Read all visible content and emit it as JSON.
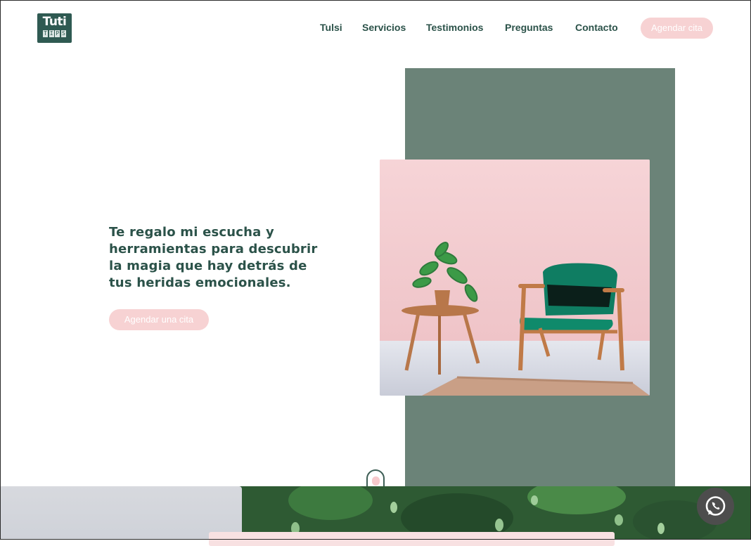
{
  "brand": {
    "logo_main": "Tuti",
    "logo_sub": [
      "T",
      "I",
      "P",
      "S"
    ]
  },
  "nav": {
    "items": [
      "Tulsi",
      "Servicios",
      "Testimonios",
      "Preguntas",
      "Contacto"
    ],
    "cta_label": "Agendar cita"
  },
  "hero": {
    "headline": "Te regalo mi escucha y herramientas para descubrir la magia que hay detrás de tus heridas emocionales.",
    "cta_label": "Agendar una cita"
  },
  "icons": {
    "whatsapp": "whatsapp-icon",
    "scroll": "scroll-down-indicator"
  },
  "colors": {
    "brand_green": "#2b5249",
    "panel_green": "#6b8378",
    "accent_pink": "#f7d2d3",
    "whatsapp_bg": "#4d4d4d"
  }
}
